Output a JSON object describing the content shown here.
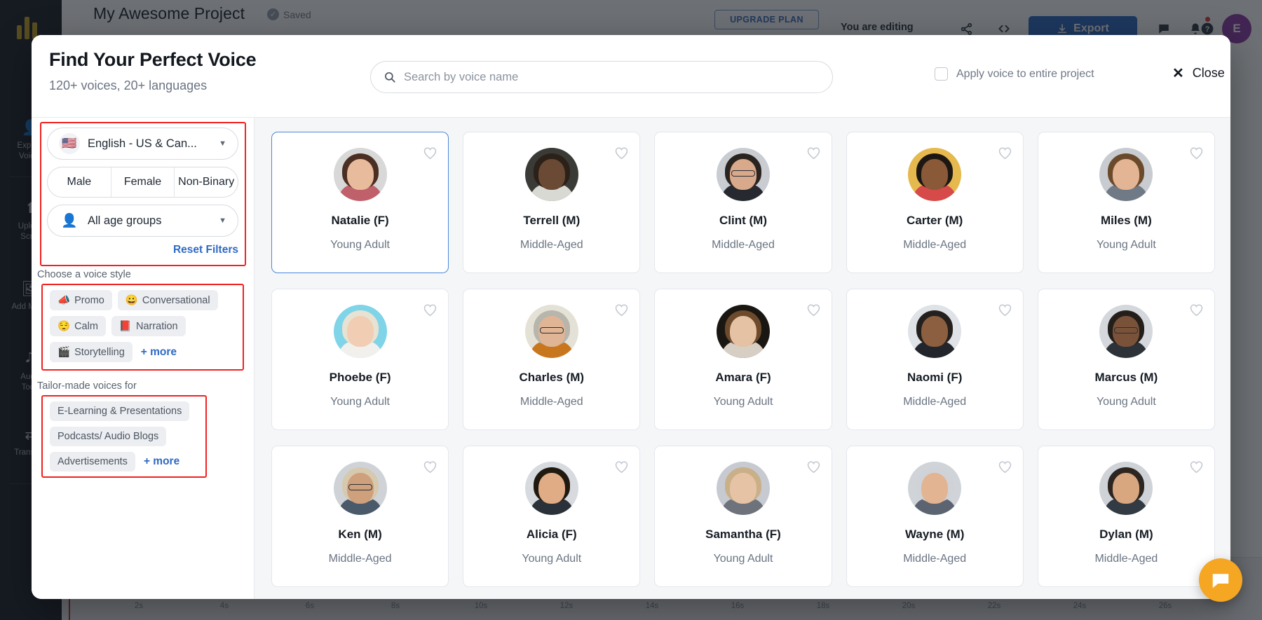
{
  "background": {
    "project_title": "My Awesome Project",
    "saved_label": "Saved",
    "upgrade_label": "UPGRADE PLAN",
    "editing_label": "You are editing",
    "export_label": "Export",
    "avatar_initial": "E",
    "toolbar_icons": [
      {
        "name": "share-icon",
        "glyph": "⟨"
      },
      {
        "name": "code-icon",
        "glyph": "‹›"
      },
      {
        "name": "comment-icon",
        "glyph": "■"
      },
      {
        "name": "bell-icon",
        "glyph": "ὑ4"
      },
      {
        "name": "help-icon",
        "glyph": "?"
      }
    ],
    "rail_items": [
      {
        "label": "Explore\nVoices",
        "glyph": "👤"
      },
      {
        "label": "Upload\nScript",
        "glyph": "⬆"
      },
      {
        "label": "Add Media",
        "glyph": "🖼"
      },
      {
        "label": "Audio\nTools",
        "glyph": "🎛"
      },
      {
        "label": "Translate",
        "glyph": "⇄"
      }
    ],
    "timeline_ticks": [
      "2s",
      "4s",
      "6s",
      "8s",
      "10s",
      "12s",
      "14s",
      "16s",
      "18s",
      "20s",
      "22s",
      "24s",
      "26s"
    ]
  },
  "modal": {
    "title": "Find Your Perfect Voice",
    "subtitle": "120+ voices, 20+ languages",
    "search": {
      "placeholder": "Search by voice name",
      "value": ""
    },
    "apply_label": "Apply voice to entire project",
    "apply_checked": false,
    "close_label": "Close"
  },
  "filters": {
    "language": {
      "value": "English - US & Can...",
      "flag": "🇺🇸"
    },
    "gender_options": [
      "Male",
      "Female",
      "Non-Binary"
    ],
    "age": {
      "value": "All age groups"
    },
    "reset_label": "Reset Filters",
    "style_heading": "Choose a voice style",
    "styles": [
      {
        "label": "Promo",
        "emoji": "📣"
      },
      {
        "label": "Conversational",
        "emoji": "😀"
      },
      {
        "label": "Calm",
        "emoji": "😌"
      },
      {
        "label": "Narration",
        "emoji": "📕"
      },
      {
        "label": "Storytelling",
        "emoji": "🎬"
      }
    ],
    "styles_more_label": "+ more",
    "tailor_heading": "Tailor-made voices for",
    "tailor": [
      {
        "label": "E-Learning & Presentations"
      },
      {
        "label": "Podcasts/ Audio Blogs"
      },
      {
        "label": "Advertisements"
      }
    ],
    "tailor_more_label": "+ more"
  },
  "voices": [
    {
      "name": "Natalie (F)",
      "age": "Young Adult",
      "selected": true,
      "skin": "#e8bb9c",
      "hair": "#4a2f22",
      "bg": "#d8d8d8",
      "body": "#c0606a",
      "glasses": false
    },
    {
      "name": "Terrell (M)",
      "age": "Middle-Aged",
      "selected": false,
      "skin": "#6b4a35",
      "hair": "#2b2119",
      "bg": "#3a3a36",
      "body": "#d9d9d4",
      "glasses": false
    },
    {
      "name": "Clint (M)",
      "age": "Middle-Aged",
      "selected": false,
      "skin": "#d9a98b",
      "hair": "#2a2420",
      "bg": "#c9cdd2",
      "body": "#262a30",
      "glasses": true
    },
    {
      "name": "Carter (M)",
      "age": "Middle-Aged",
      "selected": false,
      "skin": "#8a5a38",
      "hair": "#1d1713",
      "bg": "#e6b94f",
      "body": "#d64a4a",
      "glasses": false
    },
    {
      "name": "Miles (M)",
      "age": "Young Adult",
      "selected": false,
      "skin": "#e3b594",
      "hair": "#6b4a2c",
      "bg": "#c8ccd1",
      "body": "#6f7a86",
      "glasses": false
    },
    {
      "name": "Phoebe (F)",
      "age": "Young Adult",
      "selected": false,
      "skin": "#f0cdb3",
      "hair": "#e8e2d2",
      "bg": "#7fd4e8",
      "body": "#f2f0ec",
      "glasses": false
    },
    {
      "name": "Charles (M)",
      "age": "Middle-Aged",
      "selected": false,
      "skin": "#e0b595",
      "hair": "#b8b5ad",
      "bg": "#e4e1d6",
      "body": "#c8771f",
      "glasses": true
    },
    {
      "name": "Amara (F)",
      "age": "Young Adult",
      "selected": false,
      "skin": "#e6c2a4",
      "hair": "#6d4a2b",
      "bg": "#1a1713",
      "body": "#d8cfc4",
      "glasses": false
    },
    {
      "name": "Naomi (F)",
      "age": "Middle-Aged",
      "selected": false,
      "skin": "#8b5f40",
      "hair": "#24201d",
      "bg": "#dfe2e6",
      "body": "#22262c",
      "glasses": false
    },
    {
      "name": "Marcus (M)",
      "age": "Young Adult",
      "selected": false,
      "skin": "#7a523a",
      "hair": "#241e1a",
      "bg": "#d4d7dc",
      "body": "#2c3238",
      "glasses": true
    },
    {
      "name": "Ken (M)",
      "age": "Middle-Aged",
      "selected": false,
      "skin": "#cfa07c",
      "hair": "#d6c9ae",
      "bg": "#cfd3d8",
      "body": "#4b5a6b",
      "glasses": true
    },
    {
      "name": "Alicia (F)",
      "age": "Young Adult",
      "selected": false,
      "skin": "#e0ac85",
      "hair": "#20190f",
      "bg": "#d7dade",
      "body": "#2b3138",
      "glasses": false
    },
    {
      "name": "Samantha (F)",
      "age": "Young Adult",
      "selected": false,
      "skin": "#e7c3a6",
      "hair": "#c9b089",
      "bg": "#c7cad0",
      "body": "#6e737b",
      "glasses": false
    },
    {
      "name": "Wayne (M)",
      "age": "Middle-Aged",
      "selected": false,
      "skin": "#e2b491",
      "hair": "#cfd2d6",
      "bg": "#d0d4d9",
      "body": "#5b6470",
      "glasses": false
    },
    {
      "name": "Dylan (M)",
      "age": "Middle-Aged",
      "selected": false,
      "skin": "#d8a780",
      "hair": "#2c2520",
      "bg": "#cfd3d8",
      "body": "#323a43",
      "glasses": false
    }
  ],
  "chat": {
    "icon": "chat-icon"
  }
}
